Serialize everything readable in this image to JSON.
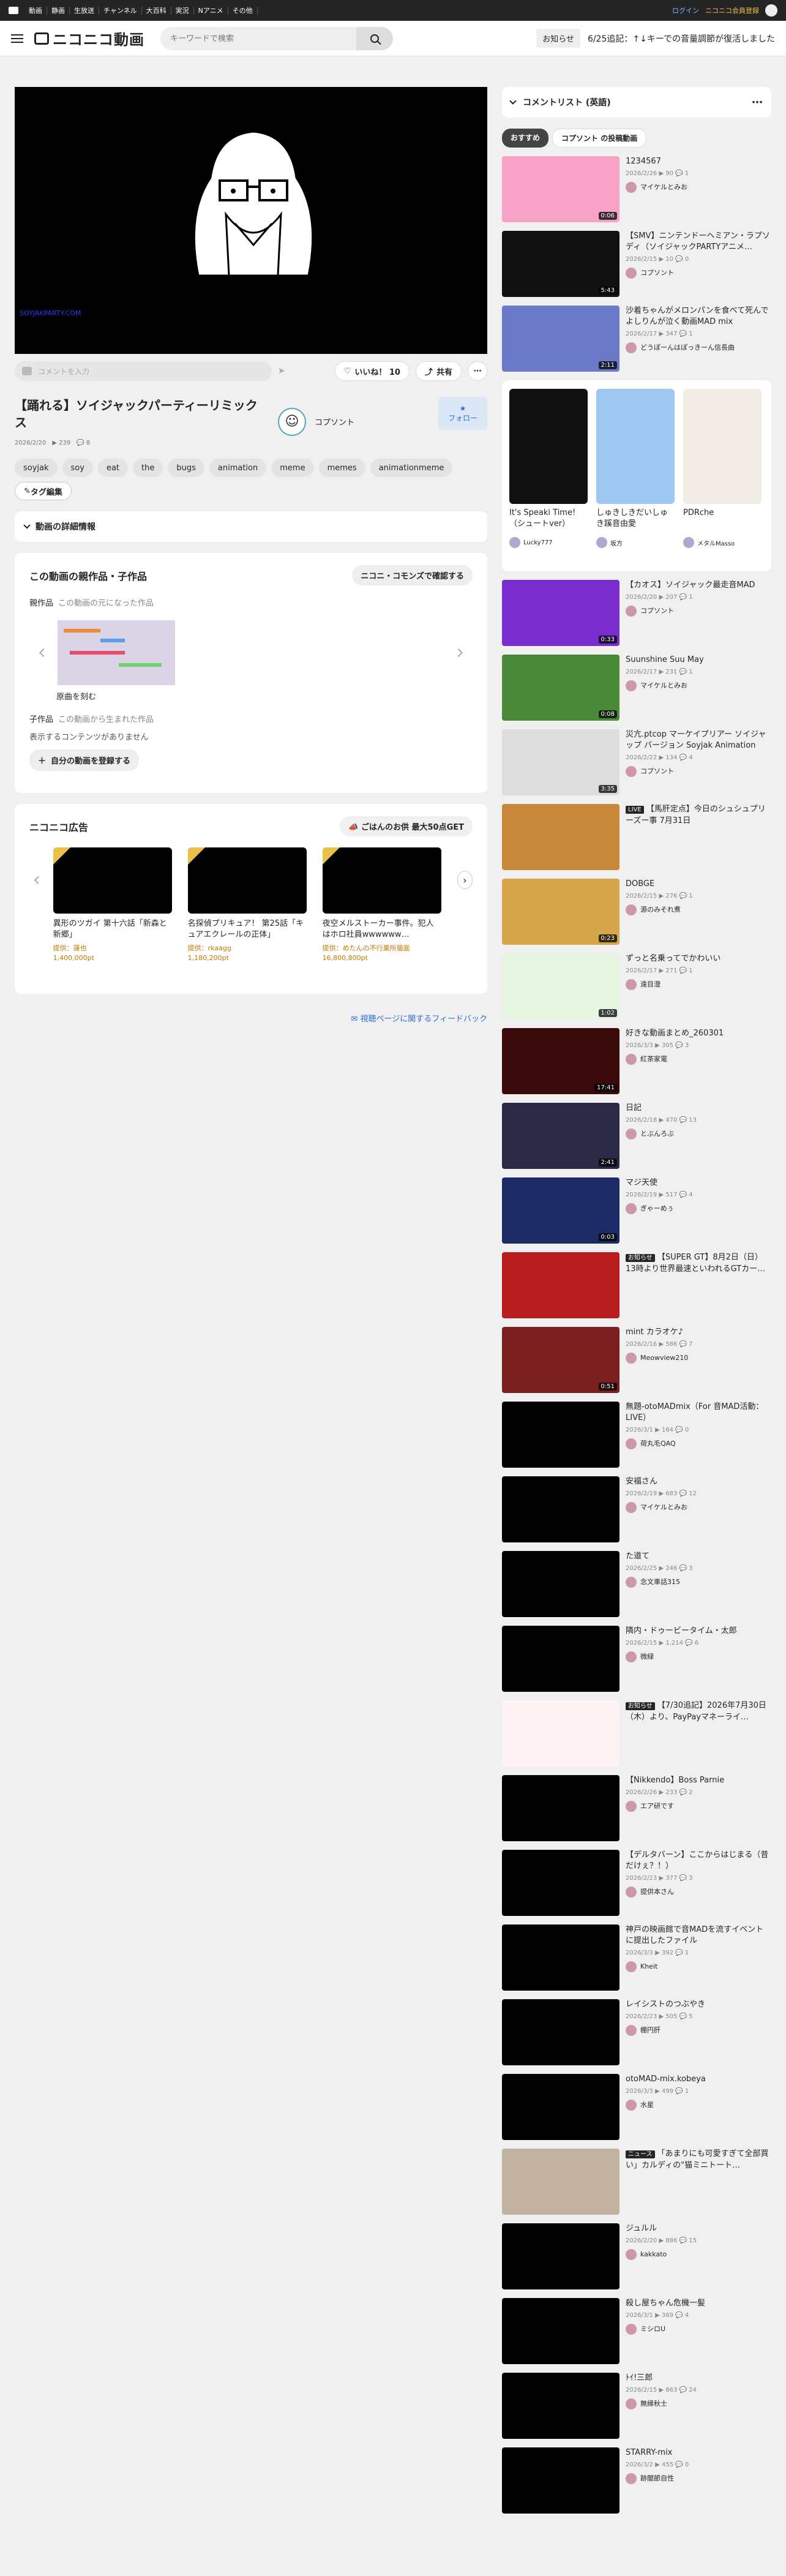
{
  "topbar": {
    "nav": [
      "動画",
      "静画",
      "生放送",
      "チャンネル",
      "大百科",
      "実況",
      "Nアニメ",
      "その他"
    ],
    "login": "ログイン",
    "premium": "ニコニコ会員登録"
  },
  "header": {
    "brand": "ニコニコ動画",
    "search_placeholder": "キーワードで検索",
    "notice_label": "お知らせ",
    "notice_text": "6/25追記：↑↓キーでの音量調節が復活しました"
  },
  "video": {
    "title": "【踊れる】ソイジャックパーティーリミックス",
    "date": "2026/2/20",
    "views": "239",
    "comments": "8",
    "owner": "コプソント",
    "follow": "フォロー",
    "comment_placeholder": "コメントを入力",
    "like": "いいね！ 10",
    "share": "共有",
    "watermark": "SOYJAKPARTY.COM"
  },
  "tags": [
    "soyjak",
    "soy",
    "eat",
    "the",
    "bugs",
    "animation",
    "meme",
    "memes",
    "animationmeme"
  ],
  "tag_edit": "タグ編集",
  "details": "動画の詳細情報",
  "parents": {
    "title": "この動画の親作品・子作品",
    "commons": "ニコニ・コモンズで確認する",
    "parent_label": "親作品",
    "parent_desc": "この動画の元になった作品",
    "parent_item": "原曲を刻む",
    "child_label": "子作品",
    "child_desc": "この動画から生まれた作品",
    "child_empty": "表示するコンテンツがありません",
    "register": "自分の動画を登録する"
  },
  "ads": {
    "title": "ニコニコ広告",
    "gift": "ごはんのお供 最大50点GET",
    "items": [
      {
        "title": "異形のツガイ 第十六話「新森と新郷」",
        "by": "提供：蓮也",
        "pts": "1,400,000pt"
      },
      {
        "title": "名探偵プリキュア！ 第25話「キュアエクレールの正体」",
        "by": "提供：rkaagg",
        "pts": "1,180,200pt"
      },
      {
        "title": "夜空メルストーカー事件。犯人はホロ社員wwwwww…",
        "by": "提供：めたんの不行業所猫面",
        "pts": "16,800,800pt"
      }
    ]
  },
  "feedback": "視聴ページに関するフィードバック",
  "commentlist": "コメントリスト (英語)",
  "rtabs": {
    "rec": "おすすめ",
    "owner": "コプソント の投稿動画"
  },
  "colors": {
    "accent": "#2c6ed5",
    "ad": "#c07a00"
  },
  "side_top": [
    {
      "title": "1234567",
      "meta": "2026/2/26 ▶ 90 💬 1",
      "owner": "マイケルとみお",
      "dur": "0:06",
      "c": "#f7a3c8"
    },
    {
      "title": "【SMV】ニンテンドーヘミアン・ラプソディ（ソイジャックPARTYアニメ…",
      "meta": "2026/2/15 ▶ 10 💬 0",
      "owner": "コプソント",
      "dur": "5:43",
      "c": "#111"
    },
    {
      "title": "沙着ちゃんがメロンパンを食べて死んでよしりんが泣く動画MAD mix",
      "meta": "2026/2/17 ▶ 347 💬 1",
      "owner": "どうぽーんはぽっきーん信長曲",
      "dur": "2:11",
      "c": "#6a7ac8"
    }
  ],
  "trio": [
    {
      "title": "It's Speaki Time!（シュートver）",
      "owner": "Lucky777",
      "c": "#111"
    },
    {
      "title": "しゅきしきだいしゅき蹊音由愛",
      "owner": "坂方",
      "c": "#9ec8f2"
    },
    {
      "title": "PDRche",
      "owner": "メタルMasso",
      "c": "#f2ece6"
    }
  ],
  "side_list": [
    {
      "title": "【カオス】ソイジャック最走音MAD",
      "meta": "2026/2/20 ▶ 207 💬 1",
      "owner": "コプソント",
      "dur": "0:33",
      "c": "#7a2dcf",
      "badge": ""
    },
    {
      "title": "Suunshine Suu May",
      "meta": "2026/2/17 ▶ 231 💬 1",
      "owner": "マイケルとみお",
      "dur": "0:08",
      "c": "#4a8a3a",
      "badge": ""
    },
    {
      "title": "災亢.ptcop マーケイプリアー ソイジャップ バージョン Soyjak Animation",
      "meta": "2026/2/22 ▶ 134 💬 4",
      "owner": "コプソント",
      "dur": "3:35",
      "c": "#ddd",
      "badge": ""
    },
    {
      "title": "【馬肝定点】今日のシュシュプリーズー事 7月31日",
      "meta": "",
      "owner": "",
      "dur": "",
      "c": "#c8883a",
      "badge": "LIVE"
    },
    {
      "title": "DOBGE",
      "meta": "2026/2/15 ▶ 276 💬 1",
      "owner": "源のみそれ煮",
      "dur": "0:23",
      "c": "#d8a64a",
      "badge": ""
    },
    {
      "title": "ずっと名乗ってでかわいい",
      "meta": "2026/2/17 ▶ 271 💬 1",
      "owner": "遠目澄",
      "dur": "1:02",
      "c": "#e8f4e2",
      "badge": ""
    },
    {
      "title": "好きな動画まとめ_260301",
      "meta": "2026/3/3 ▶ 305 💬 3",
      "owner": "紅茶家電",
      "dur": "17:41",
      "c": "#3a0a0a",
      "badge": ""
    },
    {
      "title": "日記",
      "meta": "2026/2/18 ▶ 470 💬 13",
      "owner": "とぶんろぶ",
      "dur": "2:41",
      "c": "#2a2a44",
      "badge": ""
    },
    {
      "title": "マジ天使",
      "meta": "2026/2/19 ▶ 517 💬 4",
      "owner": "ぎゃーめぅ",
      "dur": "0:03",
      "c": "#1c2a66",
      "badge": ""
    },
    {
      "title": "【SUPER GT】8月2日（日）13時より世界最速といわれるGTカー…",
      "meta": "",
      "owner": "",
      "dur": "",
      "c": "#b81c1c",
      "badge": "お知らせ"
    },
    {
      "title": "mint カラオケ♪",
      "meta": "2026/2/16 ▶ 586 💬 7",
      "owner": "Meowview210",
      "dur": "0:51",
      "c": "#7a2020",
      "badge": ""
    },
    {
      "title": "無題-otoMADmix（For 音MAD活動：LIVE）",
      "meta": "2026/3/1 ▶ 164 💬 0",
      "owner": "荷丸毛QAQ",
      "dur": "",
      "c": "#000",
      "badge": ""
    },
    {
      "title": "安福さん",
      "meta": "2026/2/19 ▶ 683 💬 12",
      "owner": "マイケルとみお",
      "dur": "",
      "c": "#000",
      "badge": ""
    },
    {
      "title": "た道て",
      "meta": "2026/2/25 ▶ 246 💬 3",
      "owner": "念文車話315",
      "dur": "",
      "c": "#000",
      "badge": ""
    },
    {
      "title": "隣内・ドゥービータイム・太郎",
      "meta": "2026/2/15 ▶ 1,214 💬 6",
      "owner": "微緑",
      "dur": "",
      "c": "#000",
      "badge": ""
    },
    {
      "title": "【7/30追記】2026年7月30日（木）より、PayPayマネーライ…",
      "meta": "",
      "owner": "",
      "dur": "",
      "c": "#fff2f5",
      "badge": "お知らせ"
    },
    {
      "title": "【Nikkendo】Boss Parnie",
      "meta": "2026/2/26 ▶ 233 💬 2",
      "owner": "エア研です",
      "dur": "",
      "c": "#000",
      "badge": ""
    },
    {
      "title": "【デルタバーン】ここからはじまる（昔だけぇ？！）",
      "meta": "2026/2/23 ▶ 377 💬 3",
      "owner": "提供本さん",
      "dur": "",
      "c": "#000",
      "badge": ""
    },
    {
      "title": "神戸の映画館で音MADを流すイベントに提出したファイル",
      "meta": "2026/3/3 ▶ 392 💬 1",
      "owner": "Kheit",
      "dur": "",
      "c": "#000",
      "badge": ""
    },
    {
      "title": "レイシストのつぶやき",
      "meta": "2026/2/23 ▶ 505 💬 5",
      "owner": "棚円肝",
      "dur": "",
      "c": "#000",
      "badge": ""
    },
    {
      "title": "otoMAD-mix.kobeya",
      "meta": "2026/3/3 ▶ 499 💬 1",
      "owner": "水星",
      "dur": "",
      "c": "#000",
      "badge": ""
    },
    {
      "title": "「あまりにも可愛すぎて全部買い」カルディの\"猫ミニトート…",
      "meta": "",
      "owner": "",
      "dur": "",
      "c": "#c2b2a0",
      "badge": "ニュース"
    },
    {
      "title": "ジュルル",
      "meta": "2026/2/20 ▶ 886 💬 15",
      "owner": "kakkato",
      "dur": "",
      "c": "#000",
      "badge": ""
    },
    {
      "title": "殺し屋ちゃん危機一髪",
      "meta": "2026/3/1 ▶ 369 💬 4",
      "owner": "ミシロU",
      "dur": "",
      "c": "#000",
      "badge": ""
    },
    {
      "title": "ﾄｲ!三郎",
      "meta": "2026/2/15 ▶ 863 💬 24",
      "owner": "無縁秋士",
      "dur": "",
      "c": "#000",
      "badge": ""
    },
    {
      "title": "STARRY-mix",
      "meta": "2026/3/2 ▶ 455 💬 0",
      "owner": "跡闇節自性",
      "dur": "",
      "c": "#000",
      "badge": ""
    }
  ]
}
